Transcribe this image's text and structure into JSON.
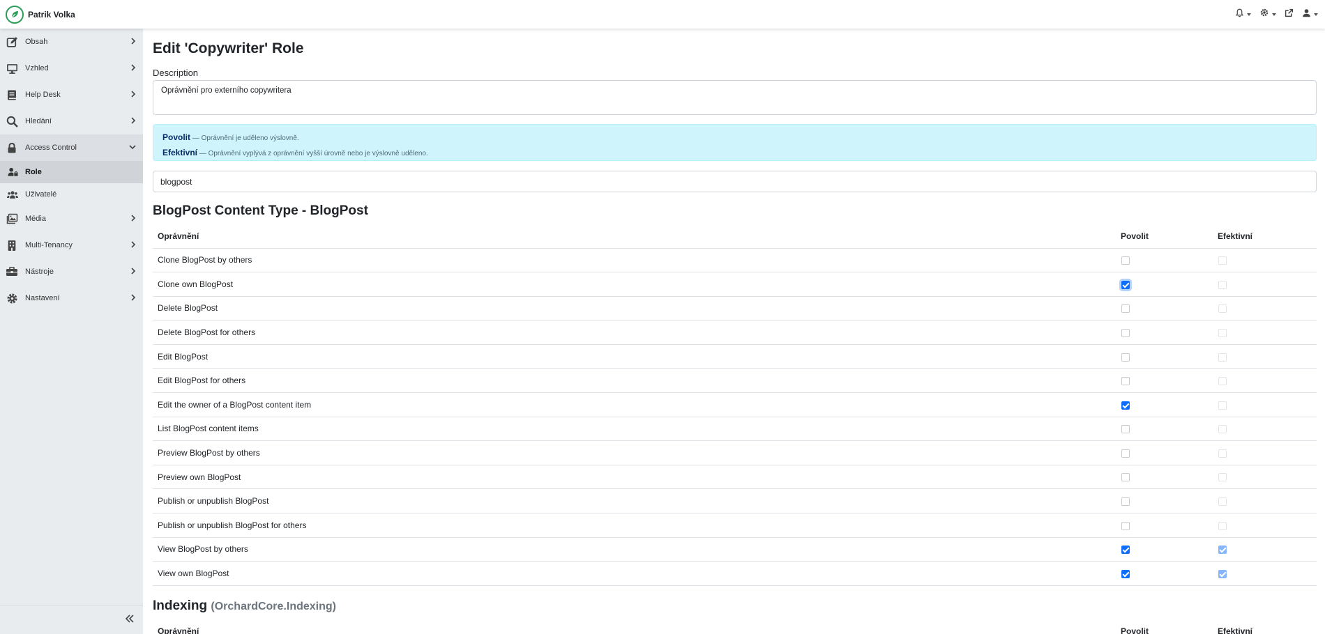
{
  "header": {
    "brand_name": "Patrik Volka"
  },
  "sidebar": {
    "items": [
      {
        "label": "Obsah",
        "icon": "edit-icon"
      },
      {
        "label": "Vzhled",
        "icon": "monitor-icon"
      },
      {
        "label": "Help Desk",
        "icon": "book-icon"
      },
      {
        "label": "Hledání",
        "icon": "search-icon"
      },
      {
        "label": "Access Control",
        "icon": "lock-icon"
      },
      {
        "label": "Média",
        "icon": "images-icon"
      },
      {
        "label": "Multi-Tenancy",
        "icon": "building-icon"
      },
      {
        "label": "Nástroje",
        "icon": "toolbox-icon"
      },
      {
        "label": "Nastavení",
        "icon": "gear-icon"
      }
    ],
    "access_control_children": [
      {
        "label": "Role",
        "icon": "user-lock-icon",
        "active": true
      },
      {
        "label": "Uživatelé",
        "icon": "users-icon",
        "active": false
      }
    ]
  },
  "page": {
    "title": "Edit 'Copywriter' Role",
    "description_label": "Description",
    "description_value": "Oprávnění pro externího copywritera",
    "info_allow_term": "Povolit",
    "info_allow_text": " — Oprávnění je uděleno výslovně.",
    "info_effective_term": "Efektivní",
    "info_effective_text": " — Oprávnění vyplývá z oprávnění vyšší úrovně nebo je výslovně uděleno.",
    "filter_value": "blogpost"
  },
  "sections": [
    {
      "title": "BlogPost Content Type - BlogPost",
      "headers": {
        "name": "Oprávnění",
        "allow": "Povolit",
        "effective": "Efektivní"
      },
      "rows": [
        {
          "name": "Clone BlogPost by others",
          "allow": false,
          "effective": false
        },
        {
          "name": "Clone own BlogPost",
          "allow": true,
          "effective": false
        },
        {
          "name": "Delete BlogPost",
          "allow": false,
          "effective": false
        },
        {
          "name": "Delete BlogPost for others",
          "allow": false,
          "effective": false
        },
        {
          "name": "Edit BlogPost",
          "allow": false,
          "effective": false
        },
        {
          "name": "Edit BlogPost for others",
          "allow": false,
          "effective": false
        },
        {
          "name": "Edit the owner of a BlogPost content item",
          "allow": true,
          "effective": false
        },
        {
          "name": "List BlogPost content items",
          "allow": false,
          "effective": false
        },
        {
          "name": "Preview BlogPost by others",
          "allow": false,
          "effective": false
        },
        {
          "name": "Preview own BlogPost",
          "allow": false,
          "effective": false
        },
        {
          "name": "Publish or unpublish BlogPost",
          "allow": false,
          "effective": false
        },
        {
          "name": "Publish or unpublish BlogPost for others",
          "allow": false,
          "effective": false
        },
        {
          "name": "View BlogPost by others",
          "allow": true,
          "effective": true
        },
        {
          "name": "View own BlogPost",
          "allow": true,
          "effective": true
        }
      ]
    },
    {
      "title": "Indexing",
      "subtitle": "(OrchardCore.Indexing)",
      "headers": {
        "name": "Oprávnění",
        "allow": "Povolit",
        "effective": "Efektivní"
      }
    }
  ],
  "colors": {
    "accent": "#0d6efd",
    "sidebar_bg": "#e9ecef",
    "info_bg": "#cff4fc",
    "brand_green": "#2e9d5a"
  }
}
